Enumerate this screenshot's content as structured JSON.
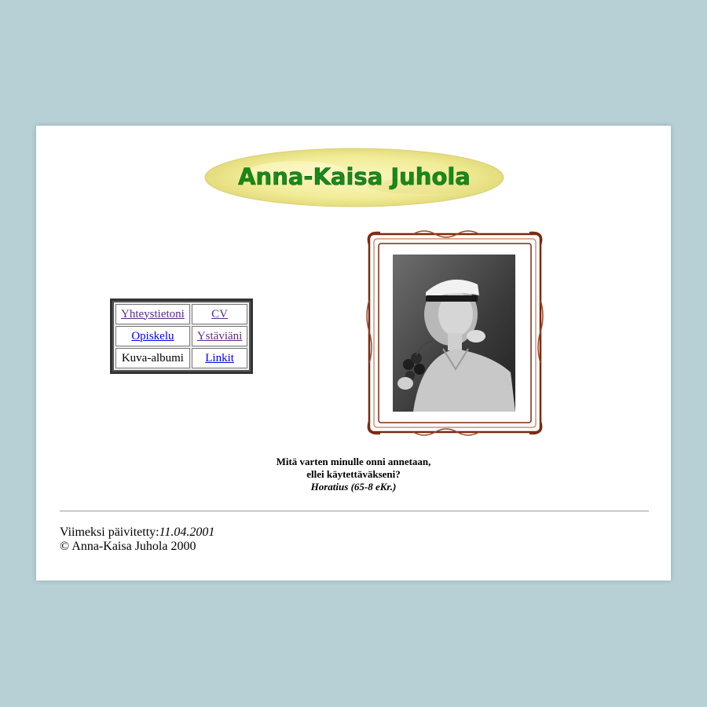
{
  "header": {
    "title": "Anna-Kaisa Juhola"
  },
  "nav": {
    "rows": [
      [
        {
          "label": "Yhteystietoni",
          "link": true,
          "color": "#5b2a86"
        },
        {
          "label": "CV",
          "link": true,
          "color": "#5b2a86"
        }
      ],
      [
        {
          "label": "Opiskelu",
          "link": true,
          "color": "#0000ee"
        },
        {
          "label": "Ystäviäni",
          "link": true,
          "color": "#5b2a86"
        }
      ],
      [
        {
          "label": "Kuva-albumi",
          "link": false,
          "color": "#000000"
        },
        {
          "label": "Linkit",
          "link": true,
          "color": "#0000ee"
        }
      ]
    ]
  },
  "quote": {
    "line1": "Mitä varten minulle onni annetaan,",
    "line2": "ellei käytettäväkseni?",
    "author": "Horatius (65-8 eKr.)"
  },
  "footer": {
    "updated_label": "Viimeksi päivitetty:",
    "updated_date": "11.04.2001",
    "copyright": "© Anna-Kaisa Juhola 2000"
  },
  "colors": {
    "background": "#b6d0d6",
    "title_green": "#1a8a1a",
    "banner_yellow": "#f4ef9e",
    "frame_brown": "#7a2a10"
  }
}
